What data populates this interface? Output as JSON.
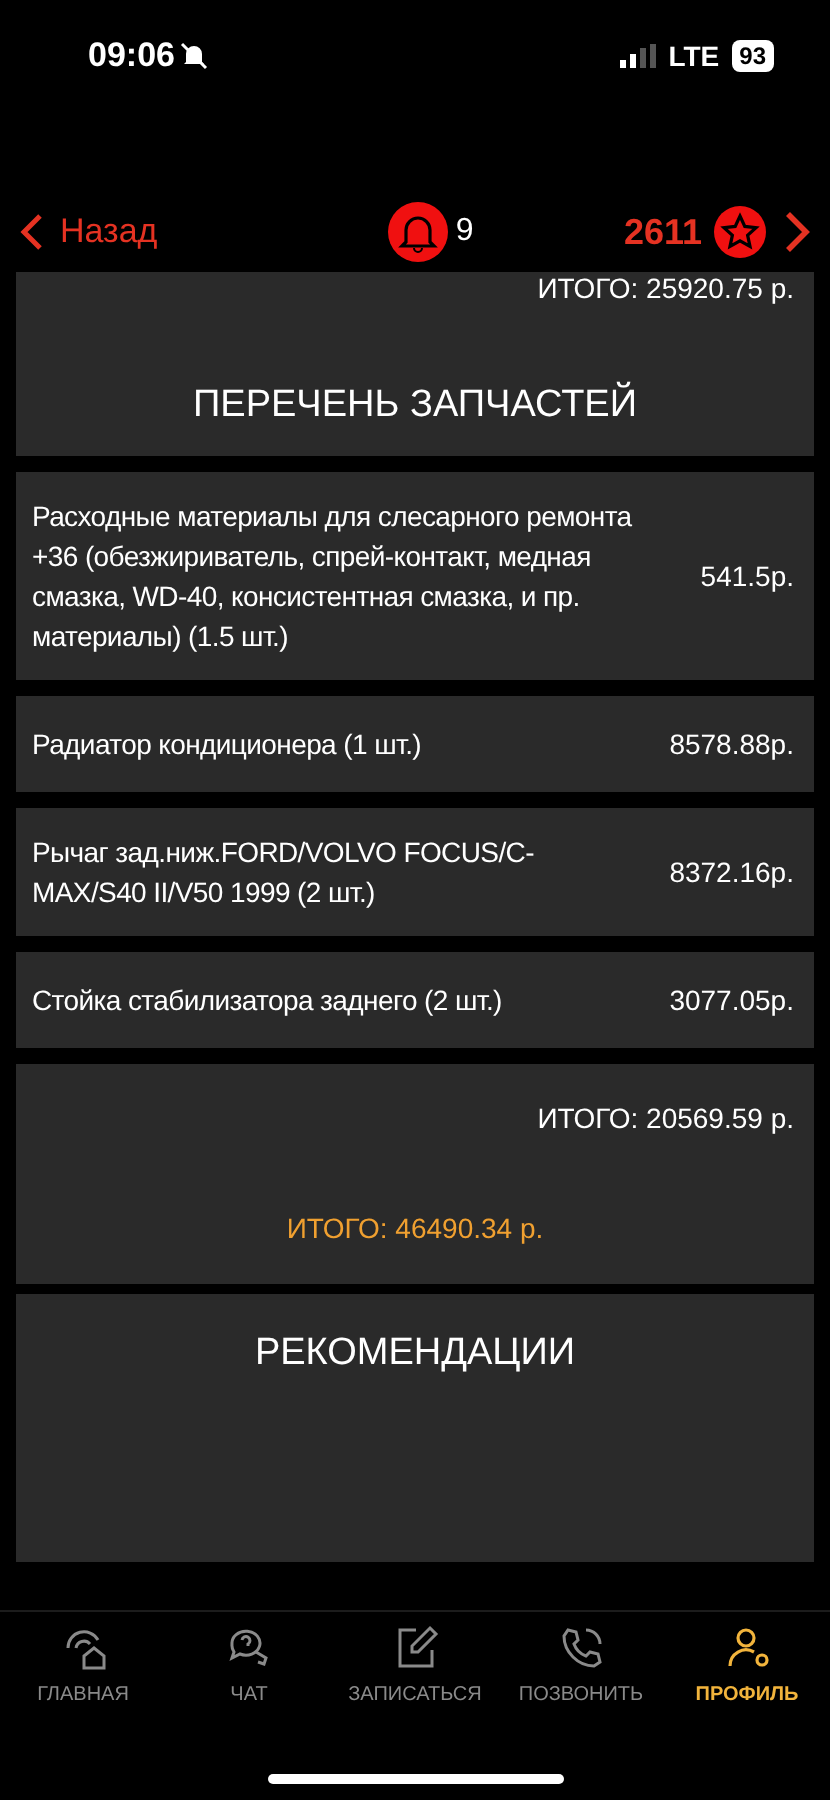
{
  "status_bar": {
    "time": "09:06",
    "network": "LTE",
    "battery": "93"
  },
  "header": {
    "back": "Назад",
    "notifications": "9",
    "points": "2611"
  },
  "previous_total": "ИТОГО: 25920.75 р.",
  "parts": {
    "title": "ПЕРЕЧЕНЬ ЗАПЧАСТЕЙ",
    "items": [
      {
        "name": "Расходные материалы для слесарного ремонта +36 (обезжириватель, спрей-контакт, медная смазка, WD-40, консистентная смазка, и пр. материалы) (1.5 шт.)",
        "price": "541.5р."
      },
      {
        "name": "Радиатор кондиционера (1 шт.)",
        "price": "8578.88р."
      },
      {
        "name": "Рычаг зад.ниж.FORD/VOLVO FOCUS/C-MAX/S40 II/V50 1999 (2 шт.)",
        "price": "8372.16р."
      },
      {
        "name": "Стойка стабилизатора заднего (2 шт.)",
        "price": "3077.05р."
      }
    ],
    "total": "ИТОГО: 20569.59 р."
  },
  "grand_total": "ИТОГО: 46490.34 р.",
  "recommendations": {
    "title": "РЕКОМЕНДАЦИИ"
  },
  "tab_bar": [
    {
      "label": "ГЛАВНАЯ",
      "kind": "home",
      "selected": false
    },
    {
      "label": "ЧАТ",
      "kind": "chat",
      "selected": false
    },
    {
      "label": "ЗАПИСАТЬСЯ",
      "kind": "edit",
      "selected": false
    },
    {
      "label": "ПОЗВОНИТЬ",
      "kind": "call",
      "selected": false
    },
    {
      "label": "ПРОФИЛЬ",
      "kind": "profile",
      "selected": true
    }
  ]
}
